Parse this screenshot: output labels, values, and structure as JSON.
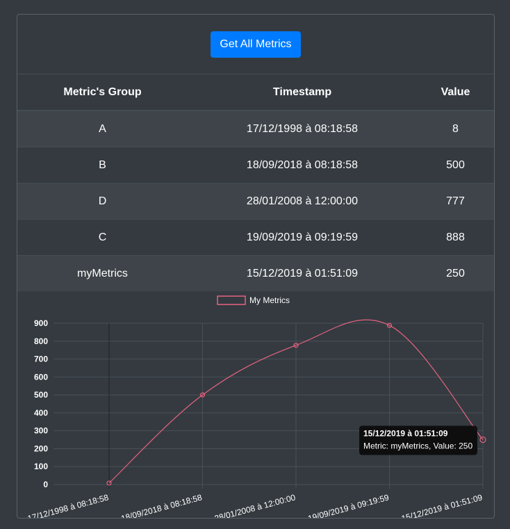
{
  "toolbar": {
    "get_all_label": "Get All Metrics"
  },
  "table": {
    "headers": [
      "Metric's Group",
      "Timestamp",
      "Value"
    ],
    "rows": [
      [
        "A",
        "17/12/1998 à 08:18:58",
        "8"
      ],
      [
        "B",
        "18/09/2018 à 08:18:58",
        "500"
      ],
      [
        "D",
        "28/01/2008 à 12:00:00",
        "777"
      ],
      [
        "C",
        "19/09/2019 à 09:19:59",
        "888"
      ],
      [
        "myMetrics",
        "15/12/2019 à 01:51:09",
        "250"
      ]
    ]
  },
  "chart_data": {
    "type": "line",
    "categories": [
      "17/12/1998 à 08:18:58",
      "18/09/2018 à 08:18:58",
      "28/01/2008 à 12:00:00",
      "19/09/2019 à 09:19:59",
      "15/12/2019 à 01:51:09"
    ],
    "series": [
      {
        "name": "My Metrics",
        "values": [
          8,
          500,
          777,
          888,
          250
        ]
      }
    ],
    "ylim": [
      0,
      900
    ],
    "yticks": [
      0,
      100,
      200,
      300,
      400,
      500,
      600,
      700,
      800,
      900
    ],
    "grid": true,
    "legend": "top",
    "colors": {
      "line": "#e5637f"
    },
    "tooltip": {
      "title": "15/12/2019 à 01:51:09",
      "body": "Metric: myMetrics, Value: 250"
    }
  }
}
